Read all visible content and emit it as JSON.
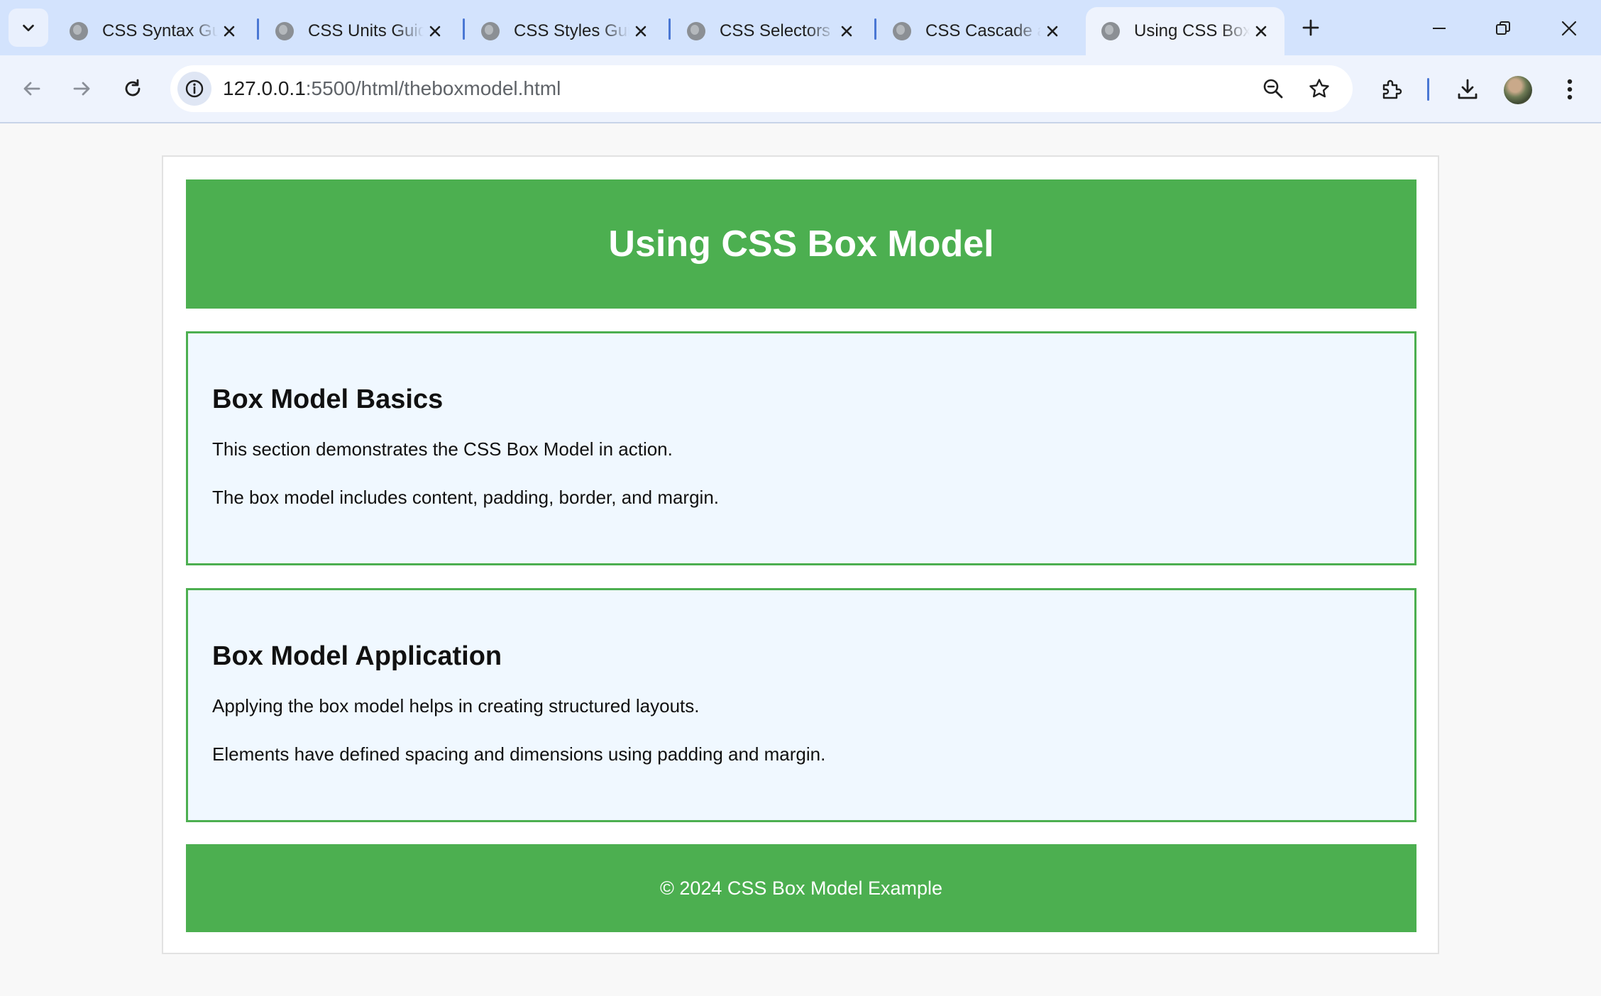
{
  "browser": {
    "tabs": [
      {
        "title": "CSS Syntax Guide",
        "active": false
      },
      {
        "title": "CSS Units Guide",
        "active": false
      },
      {
        "title": "CSS Styles Guide",
        "active": false
      },
      {
        "title": "CSS Selectors",
        "active": false
      },
      {
        "title": "CSS Cascade and Inheritance",
        "active": false
      },
      {
        "title": "Using CSS Box Model",
        "active": true
      }
    ],
    "url_host": "127.0.0.1",
    "url_rest": ":5500/html/theboxmodel.html",
    "accent": "#d3e3fd"
  },
  "page": {
    "header_title": "Using CSS Box Model",
    "sections": [
      {
        "heading": "Box Model Basics",
        "paragraphs": [
          "This section demonstrates the CSS Box Model in action.",
          "The box model includes content, padding, border, and margin."
        ]
      },
      {
        "heading": "Box Model Application",
        "paragraphs": [
          "Applying the box model helps in creating structured layouts.",
          "Elements have defined spacing and dimensions using padding and margin."
        ]
      }
    ],
    "footer_text": "© 2024 CSS Box Model Example",
    "brand_green": "#4caf50",
    "section_bg": "#f0f8ff"
  }
}
